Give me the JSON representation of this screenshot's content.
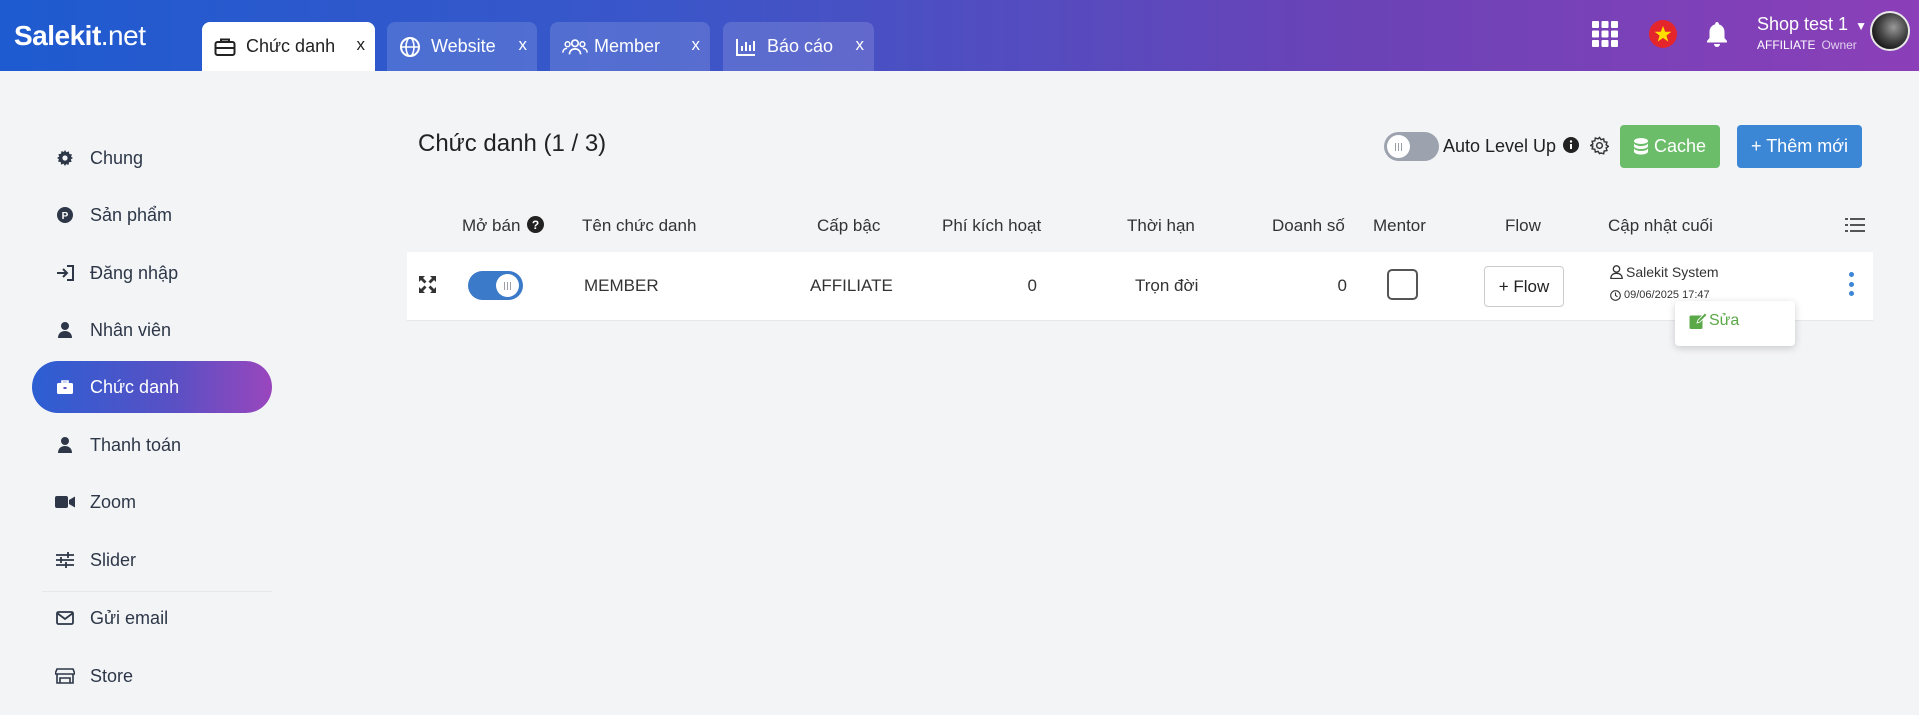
{
  "app": {
    "logo_main": "Salekit",
    "logo_suffix": ".net"
  },
  "tabs": [
    {
      "label": "Chức danh",
      "icon": "briefcase-icon",
      "close": "x"
    },
    {
      "label": "Website",
      "icon": "globe-icon",
      "close": "x"
    },
    {
      "label": "Member",
      "icon": "users-icon",
      "close": "x"
    },
    {
      "label": "Báo cáo",
      "icon": "chart-icon",
      "close": "x"
    }
  ],
  "user": {
    "name": "Shop test 1",
    "role": "AFFILIATE",
    "title": "Owner"
  },
  "sidebar": {
    "items": [
      {
        "label": "Chung",
        "icon": "gear-icon"
      },
      {
        "label": "Sản phẩm",
        "icon": "product-icon"
      },
      {
        "label": "Đăng nhập",
        "icon": "login-icon"
      },
      {
        "label": "Nhân viên",
        "icon": "user-icon"
      },
      {
        "label": "Chức danh",
        "icon": "briefcase-icon",
        "active": true
      },
      {
        "label": "Thanh toán",
        "icon": "user-icon"
      },
      {
        "label": "Zoom",
        "icon": "video-icon"
      },
      {
        "label": "Slider",
        "icon": "sliders-icon"
      },
      {
        "label": "Gửi email",
        "icon": "envelope-icon"
      },
      {
        "label": "Store",
        "icon": "store-icon"
      }
    ]
  },
  "page": {
    "title": "Chức danh (1 / 3)",
    "auto_level_up": {
      "label": "Auto Level Up",
      "enabled": false
    },
    "cache_button": "Cache",
    "add_button": "+ Thêm mới"
  },
  "table": {
    "headers": {
      "open_sale": "Mở bán",
      "name": "Tên chức danh",
      "level": "Cấp bậc",
      "fee": "Phí kích hoạt",
      "duration": "Thời hạn",
      "sales": "Doanh số",
      "mentor": "Mentor",
      "flow": "Flow",
      "updated": "Cập nhật cuối"
    },
    "rows": [
      {
        "open_sale": true,
        "name": "MEMBER",
        "level": "AFFILIATE",
        "fee": "0",
        "duration": "Trọn đời",
        "sales": "0",
        "mentor": false,
        "flow_button": "+ Flow",
        "updated_by": "Salekit System",
        "updated_at": "09/06/2025 17:47"
      }
    ]
  },
  "dropdown": {
    "edit_label": "Sửa"
  },
  "colors": {
    "accent_blue": "#3c86d6",
    "cache_green": "#6cbd6a",
    "edit_green": "#5aa848",
    "header_gradient_start": "#1e5bd0",
    "header_gradient_end": "#8b3fb8"
  }
}
